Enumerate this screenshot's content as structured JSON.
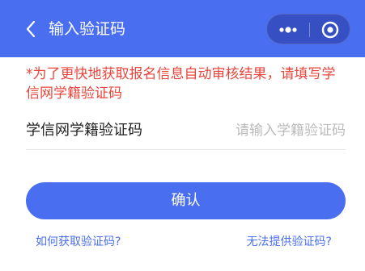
{
  "header": {
    "title": "输入验证码",
    "back_icon": "chevron-left-icon",
    "more_icon": "more-dots-icon",
    "close_icon": "target-circle-icon",
    "background_color": "#4a6ef0"
  },
  "notice": {
    "text": "*为了更快地获取报名信息自动审核结果，请填写学信网学籍验证码",
    "color": "#e8453c"
  },
  "form": {
    "label": "学信网学籍验证码",
    "value": "",
    "placeholder": "请输入学籍验证码"
  },
  "actions": {
    "confirm_label": "确认",
    "how_to_get_label": "如何获取验证码?",
    "cannot_provide_label": "无法提供验证码?"
  },
  "colors": {
    "accent": "#4a6ef0",
    "warning": "#e8453c"
  }
}
